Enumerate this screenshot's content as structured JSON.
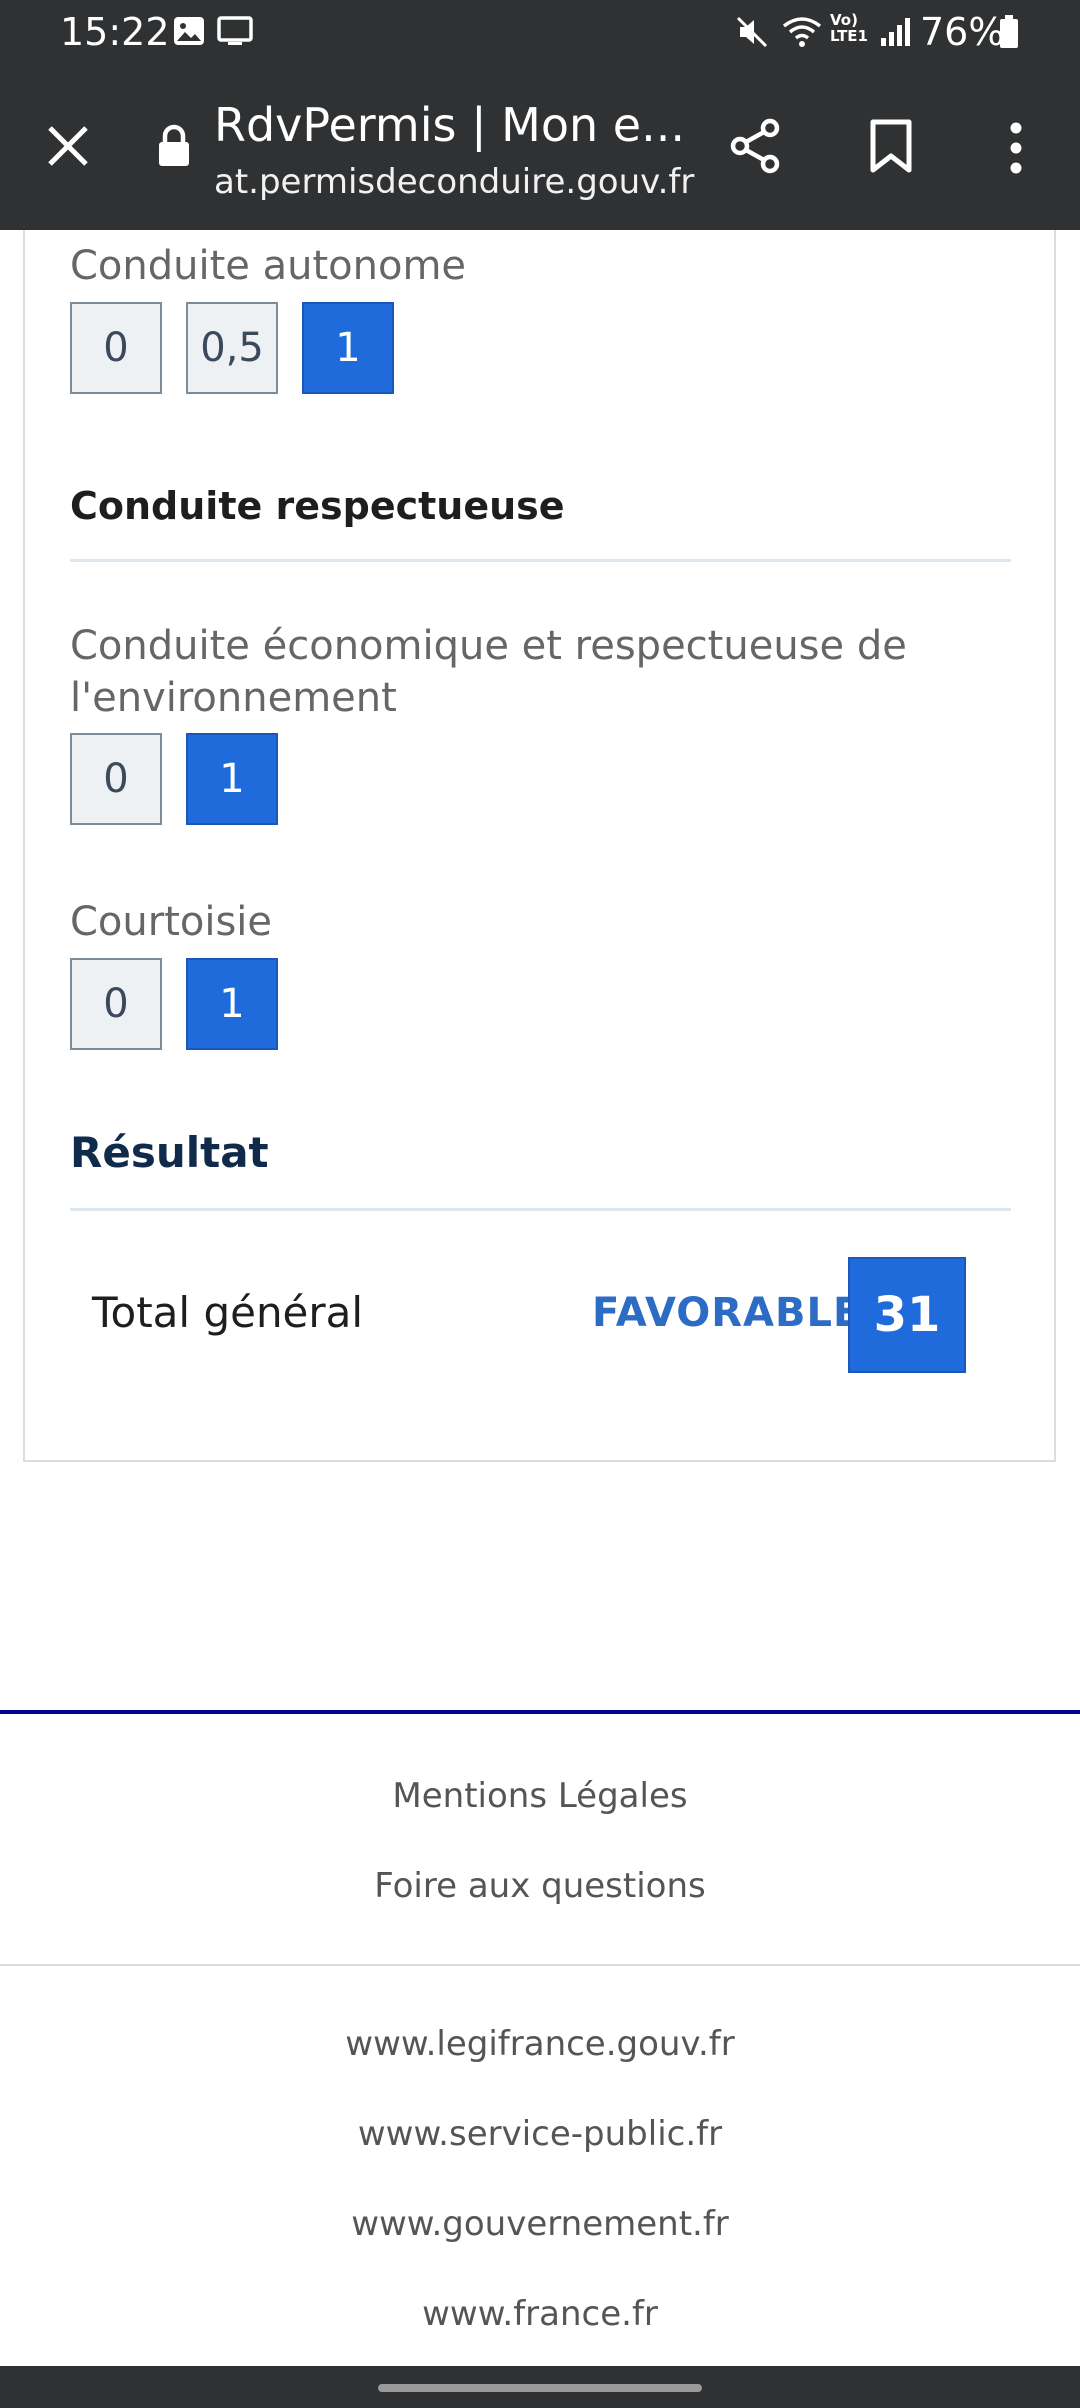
{
  "status_bar": {
    "time": "15:22",
    "battery": "76%"
  },
  "browser": {
    "title": "RdvPermis | Mon e...",
    "url": "at.permisdeconduire.gouv.fr"
  },
  "evaluation": {
    "autonomous": {
      "label": "Conduite autonome",
      "options": [
        "0",
        "0,5",
        "1"
      ],
      "selected": "1"
    },
    "respectful_section": {
      "title": "Conduite respectueuse"
    },
    "eco": {
      "label": "Conduite économique et respectueuse de l'environnement",
      "options": [
        "0",
        "1"
      ],
      "selected": "1"
    },
    "courtesy": {
      "label": "Courtoisie",
      "options": [
        "0",
        "1"
      ],
      "selected": "1"
    }
  },
  "result": {
    "title": "Résultat",
    "total_label": "Total général",
    "status": "FAVORABLE",
    "score": "31"
  },
  "footer": {
    "links_primary": [
      "Mentions Légales",
      "Foire aux questions"
    ],
    "links_secondary": [
      "www.legifrance.gouv.fr",
      "www.service-public.fr",
      "www.gouvernement.fr",
      "www.france.fr"
    ]
  },
  "colors": {
    "accent": "#1f6bdb",
    "footer_accent": "#000091",
    "chrome": "#2f3133"
  },
  "icons": [
    "image-icon",
    "monitor-icon",
    "mute-icon",
    "wifi-icon",
    "volte-icon",
    "signal-icon",
    "battery-icon",
    "close-icon",
    "lock-icon",
    "share-icon",
    "bookmark-icon",
    "more-vert-icon"
  ]
}
